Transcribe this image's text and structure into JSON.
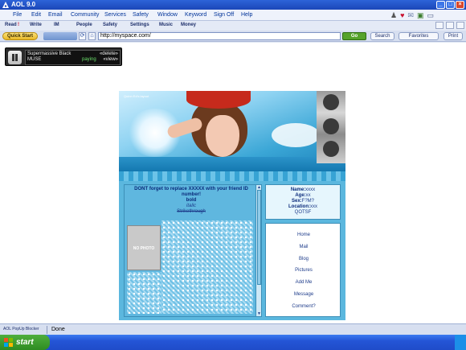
{
  "window": {
    "title": "AOL 9.0"
  },
  "menu": [
    "File",
    "Edit",
    "Email",
    "Community",
    "Services",
    "Safety",
    "Window",
    "Keyword",
    "Sign Off",
    "Help"
  ],
  "toolbar": [
    "Read",
    "Write",
    "IM",
    "People",
    "Safety",
    "Settings",
    "Music",
    "Money"
  ],
  "address": {
    "quick_start": "Quick Start",
    "url": "http://myspace.com/",
    "go": "Go",
    "search": "Search",
    "favorites": "Favorites",
    "print": "Print"
  },
  "player": {
    "track": "Supermassive Black",
    "artist": "MUSE",
    "delete": "«delete»",
    "view": "«view»",
    "status": "paying"
  },
  "myspace": {
    "banner_caption": "Quinn Ed's layout",
    "intro_1": "DONT forget to replace XXXXX with your friend ID number!",
    "bold": "bold",
    "italic": "italic",
    "strike": "Strikethrough",
    "no_photo": "NO PHOTO",
    "profile": {
      "name_label": "Name:",
      "name_value": "xxxx",
      "age_label": "Age:",
      "age_value": "xx",
      "sex_label": "Sex:",
      "sex_value": "F?M?",
      "location_label": "Location:",
      "location_value": "xxx",
      "tag": "QOTSF"
    },
    "links": [
      "Home",
      "Mail",
      "Blog",
      "Pictures",
      "Add Me",
      "Message",
      "Comment?"
    ]
  },
  "status": {
    "popups": "AOL PopUp Blocker",
    "text": "Done"
  },
  "taskbar": {
    "start": "start"
  },
  "colors": {
    "titlebar": "#1b47b8",
    "banner": "#3aa6d6",
    "ms_bg": "#5bb7de",
    "start": "#2e8c22"
  }
}
